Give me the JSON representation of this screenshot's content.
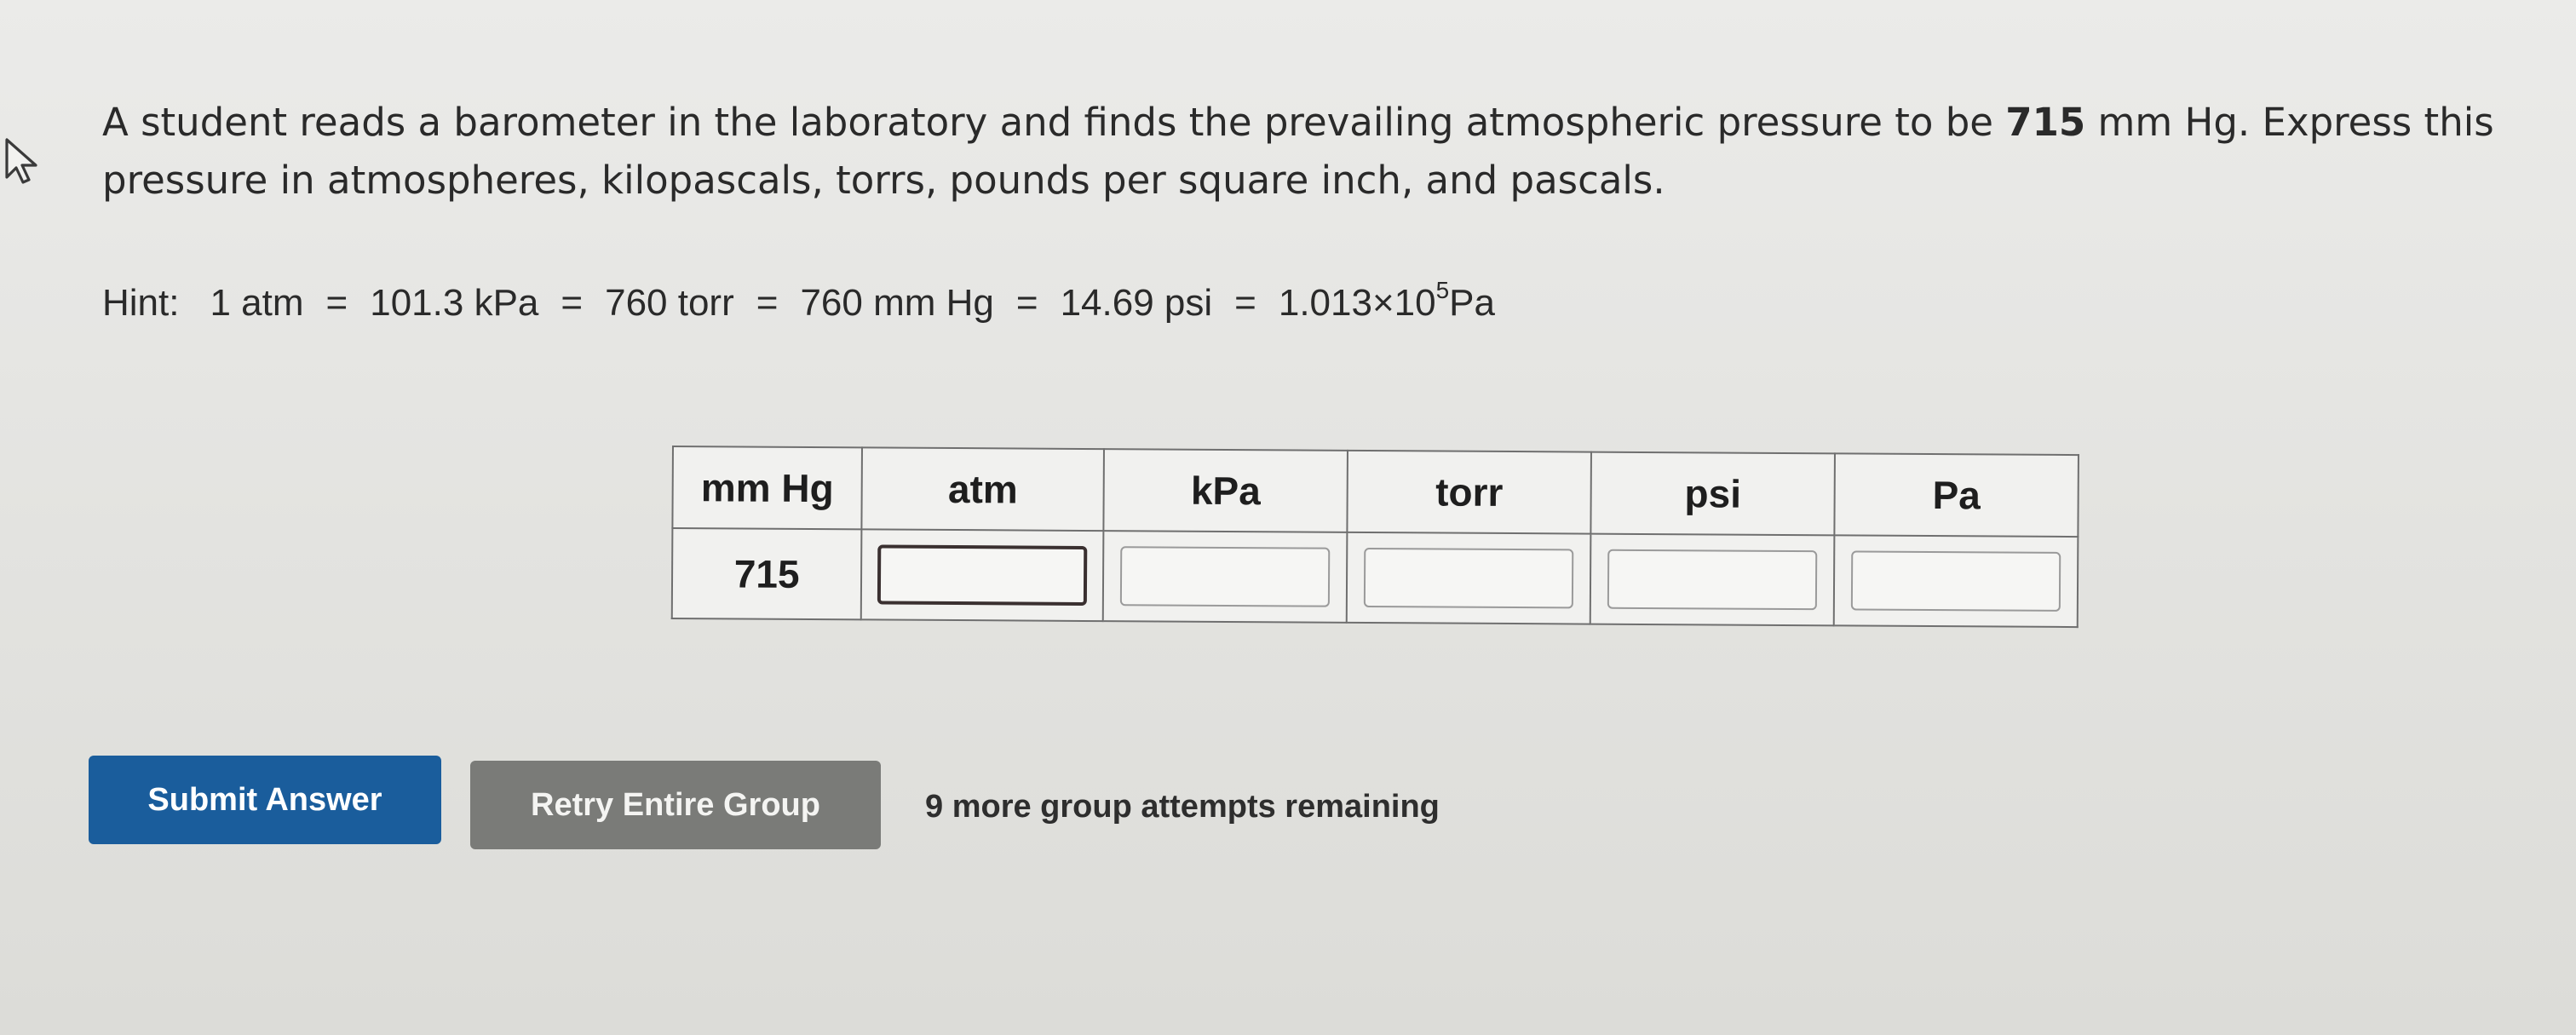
{
  "question": {
    "text_before": "A student reads a barometer in the laboratory and finds the prevailing atmospheric pressure to be ",
    "pressure_value": "715",
    "text_after": " mm Hg. Express this pressure in atmospheres, kilopascals, torrs, pounds per square inch, and pascals."
  },
  "hint": {
    "label": "Hint:",
    "atm": "1 atm",
    "kpa": "101.3 kPa",
    "torr": "760 torr",
    "mmhg": "760 mm Hg",
    "psi": "14.69 psi",
    "pa_base": "1.013×10",
    "pa_exp": "5",
    "pa_unit": " Pa",
    "equals": "="
  },
  "table": {
    "headers": [
      "mm Hg",
      "atm",
      "kPa",
      "torr",
      "psi",
      "Pa"
    ],
    "given_value": "715",
    "inputs": {
      "atm": "",
      "kpa": "",
      "torr": "",
      "psi": "",
      "pa": ""
    }
  },
  "actions": {
    "submit_label": "Submit Answer",
    "retry_label": "Retry Entire Group",
    "attempts_text": "9 more group attempts remaining"
  },
  "colors": {
    "submit_bg": "#1a5d9c",
    "retry_bg": "#7a7b78"
  }
}
